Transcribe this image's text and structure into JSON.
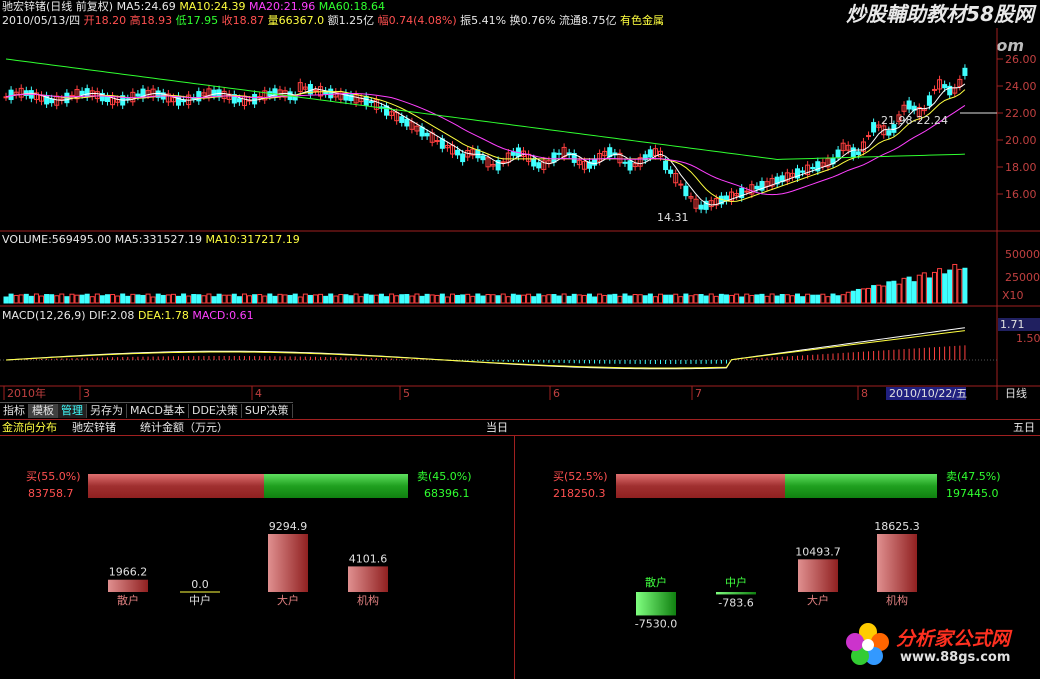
{
  "header": {
    "stock_name": "驰宏锌锗",
    "period": "(日线 前复权)",
    "ma5": "MA5:24.69",
    "ma10": "MA10:24.39",
    "ma20": "MA20:21.96",
    "ma60": "MA60:18.64",
    "date": "2010/05/13/四",
    "open": "开18.20",
    "high": "高18.93",
    "low": "低17.95",
    "close": "收18.87",
    "volume": "量66367.0",
    "amount": "额1.25亿",
    "change": "幅0.74(4.08%)",
    "amplitude": "振5.41%",
    "turnover": "换0.76%",
    "float_shares": "流通8.75亿",
    "sector": "有色金属",
    "watermark_top": "炒股輔助教材58股网",
    "watermark_top_url": "www.58Gu.com"
  },
  "price_axis": [
    "26.00",
    "24.00",
    "22.00",
    "20.00",
    "18.00",
    "16.00"
  ],
  "annotations": {
    "low": "14.31",
    "range": "21.98-22.24"
  },
  "volume_panel": {
    "title": "VOLUME:569495.00",
    "ma5": "MA5:331527.19",
    "ma10": "MA10:317217.19",
    "axis": [
      "50000",
      "25000"
    ],
    "unit": "X10"
  },
  "macd_panel": {
    "title": "MACD(12,26,9)",
    "dif": "DIF:2.08",
    "dea": "DEA:1.78",
    "macd": "MACD:0.61",
    "axis_current": "1.71",
    "axis": [
      "1.50"
    ]
  },
  "time_axis": {
    "labels": [
      "2010年",
      "3",
      "4",
      "5",
      "6",
      "7",
      "8"
    ],
    "current": "2010/10/22/五",
    "period": "日线"
  },
  "tabs": [
    "指标",
    "模板",
    "管理",
    "另存为",
    "MACD基本",
    "DDE决策",
    "SUP决策"
  ],
  "flow": {
    "title": "金流向分布",
    "stock": "驰宏锌锗",
    "unit_label": "统计金额（万元）",
    "left": {
      "header": "当日",
      "buy_label": "买(55.0%)",
      "buy_value": "83758.7",
      "sell_label": "卖(45.0%)",
      "sell_value": "68396.1",
      "buy_ratio": 0.55,
      "bars": [
        {
          "label": "散户",
          "value": "1966.2",
          "num": 1966.2
        },
        {
          "label": "中户",
          "value": "0.0",
          "num": 0
        },
        {
          "label": "大户",
          "value": "9294.9",
          "num": 9294.9
        },
        {
          "label": "机构",
          "value": "4101.6",
          "num": 4101.6
        }
      ]
    },
    "right": {
      "header": "五日",
      "buy_label": "买(52.5%)",
      "buy_value": "218250.3",
      "sell_label": "卖(47.5%)",
      "sell_value": "197445.0",
      "buy_ratio": 0.525,
      "bars": [
        {
          "label": "散户",
          "value": "-7530.0",
          "num": -7530.0
        },
        {
          "label": "中户",
          "value": "-783.6",
          "num": -783.6
        },
        {
          "label": "大户",
          "value": "10493.7",
          "num": 10493.7
        },
        {
          "label": "机构",
          "value": "18625.3",
          "num": 18625.3
        }
      ]
    }
  },
  "watermark_bottom": "分析家公式网",
  "watermark_bottom_url": "www.88gs.com"
}
